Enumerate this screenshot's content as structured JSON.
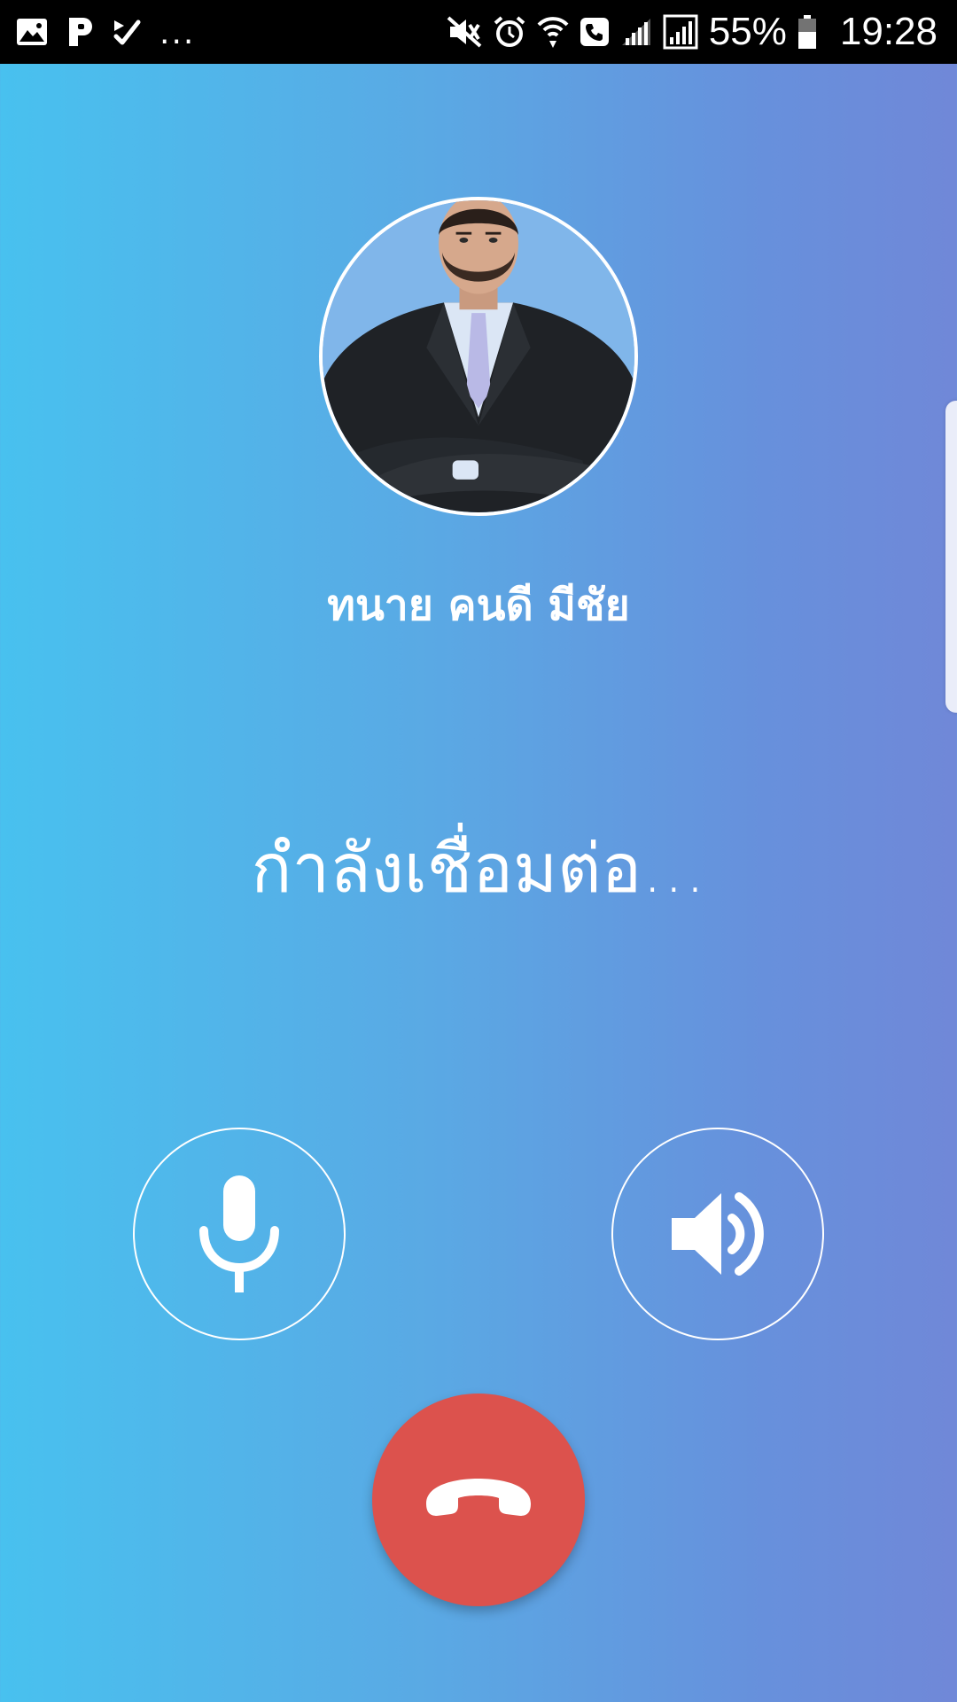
{
  "status_bar": {
    "left_icons": [
      "gallery-icon",
      "p-app-icon",
      "check-app-icon"
    ],
    "overflow": "...",
    "right_icons": [
      "mute-vibrate-icon",
      "alarm-icon",
      "wifi-call-icon",
      "phone-call-icon",
      "signal-icon",
      "signal-sim2-icon",
      "battery-icon"
    ],
    "battery_percent": "55%",
    "time": "19:28"
  },
  "caller": {
    "name": "ทนาย คนดี มีชัย",
    "status": "กำลังเชื่อมต่อ...",
    "avatar": "businessman-photo"
  },
  "controls": {
    "mute_icon": "microphone-icon",
    "speaker_icon": "speaker-icon",
    "end_call_icon": "hang-up-icon",
    "end_call_color": "#dc524d"
  },
  "colors": {
    "gradient_start": "#48c1ef",
    "gradient_end": "#7088d8"
  }
}
